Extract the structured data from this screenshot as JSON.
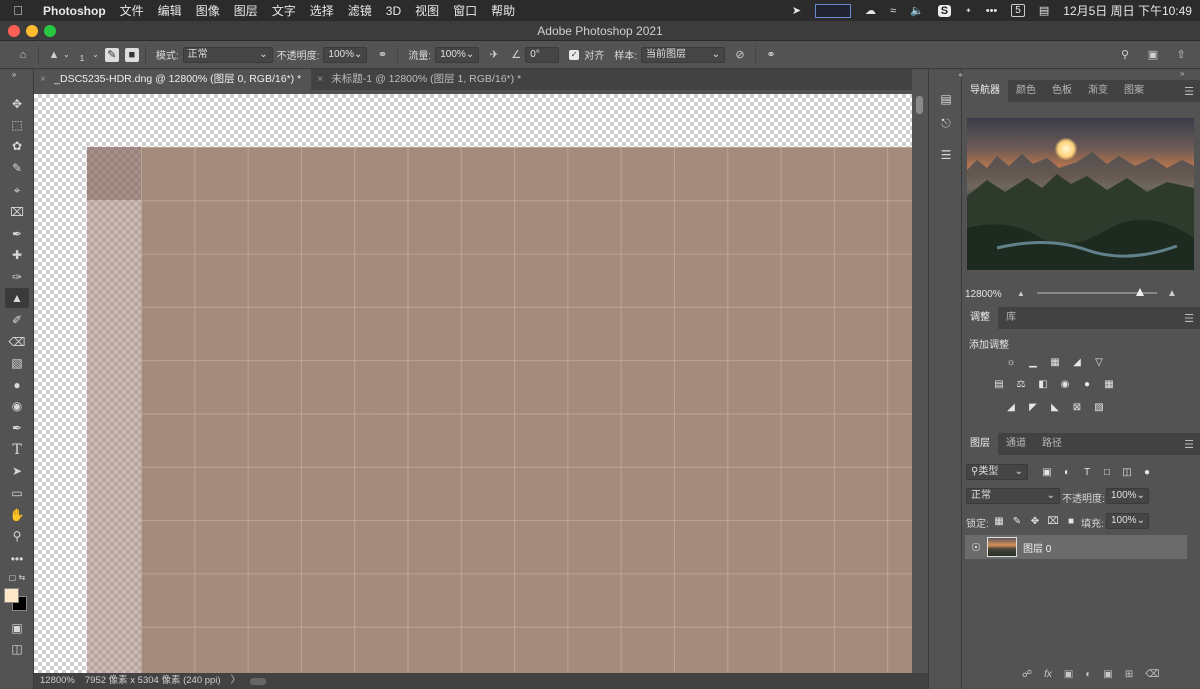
{
  "menubar": {
    "app_name": "Photoshop",
    "items": [
      "文件",
      "编辑",
      "图像",
      "图层",
      "文字",
      "选择",
      "滤镜",
      "3D",
      "视图",
      "窗口",
      "帮助"
    ],
    "clock": "12月5日 周日 下午10:49",
    "date_badge": "5"
  },
  "window": {
    "title": "Adobe Photoshop 2021"
  },
  "options": {
    "brush_size": "1",
    "mode_label": "模式:",
    "mode_value": "正常",
    "opacity_label": "不透明度:",
    "opacity_value": "100%",
    "flow_label": "流量:",
    "flow_value": "100%",
    "angle_value": "0°",
    "align_label": "对齐",
    "sample_label": "样本:",
    "sample_value": "当前图层"
  },
  "tabs": [
    {
      "label": "_DSC5235-HDR.dng @ 12800% (图层 0, RGB/16*) *"
    },
    {
      "label": "未标题-1 @ 12800% (图层 1, RGB/16*) *"
    }
  ],
  "status": {
    "zoom": "12800%",
    "dims": "7952 像素 x 5304 像素 (240 ppi)",
    "arrow": "〉"
  },
  "navigator": {
    "tabs": [
      "导航器",
      "颜色",
      "色板",
      "渐变",
      "图案"
    ],
    "zoom": "12800%",
    "zoom_slider_fraction": 0.86
  },
  "adjust": {
    "tabs": [
      "调整",
      "库"
    ],
    "heading": "添加调整"
  },
  "layers": {
    "tabs": [
      "图层",
      "通道",
      "路径"
    ],
    "filter_value": "类型",
    "blend_value": "正常",
    "opacity_label": "不透明度:",
    "opacity_value": "100%",
    "lock_label": "锁定:",
    "fill_label": "填充:",
    "fill_value": "100%",
    "layer_name": "图层 0"
  },
  "colors": {
    "foreground": "#fde9c8",
    "background": "#000000",
    "pixel": "#a48b7c"
  }
}
